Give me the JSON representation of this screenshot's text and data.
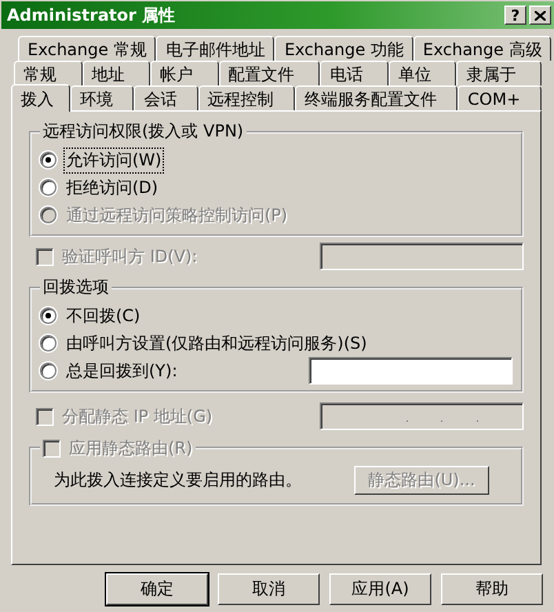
{
  "window": {
    "title": "Administrator 属性",
    "help_button": "?"
  },
  "tab_rows": [
    {
      "tabs": [
        {
          "label": "Exchange 常规",
          "selected": false
        },
        {
          "label": "电子邮件地址",
          "selected": false
        },
        {
          "label": "Exchange 功能",
          "selected": false
        },
        {
          "label": "Exchange 高级",
          "selected": false
        }
      ]
    },
    {
      "tabs": [
        {
          "label": "常规",
          "selected": false
        },
        {
          "label": "地址",
          "selected": false
        },
        {
          "label": "帐户",
          "selected": false
        },
        {
          "label": "配置文件",
          "selected": false
        },
        {
          "label": "电话",
          "selected": false
        },
        {
          "label": "单位",
          "selected": false
        },
        {
          "label": "隶属于",
          "selected": false
        }
      ]
    },
    {
      "tabs": [
        {
          "label": "拨入",
          "selected": true
        },
        {
          "label": "环境",
          "selected": false
        },
        {
          "label": "会话",
          "selected": false
        },
        {
          "label": "远程控制",
          "selected": false
        },
        {
          "label": "终端服务配置文件",
          "selected": false
        },
        {
          "label": "COM+",
          "selected": false
        }
      ]
    }
  ],
  "remote_access": {
    "legend": "远程访问权限(拨入或 VPN)",
    "options": [
      {
        "label": "允许访问(W)",
        "selected": true,
        "disabled": false,
        "focused": true
      },
      {
        "label": "拒绝访问(D)",
        "selected": false,
        "disabled": false,
        "focused": false
      },
      {
        "label": "通过远程访问策略控制访问(P)",
        "selected": false,
        "disabled": true,
        "focused": false
      }
    ]
  },
  "verify_caller_id": {
    "label": "验证呼叫方 ID(V):",
    "checked": false,
    "disabled": true
  },
  "callback": {
    "legend": "回拨选项",
    "options": [
      {
        "kind": "plain",
        "label": "不回拨(C)",
        "selected": true,
        "disabled": false
      },
      {
        "kind": "plain",
        "label": "由呼叫方设置(仅路由和远程访问服务)(S)",
        "selected": false,
        "disabled": false
      },
      {
        "kind": "with_field",
        "label": "总是回拨到(Y):",
        "selected": false,
        "disabled": false
      }
    ]
  },
  "static_ip": {
    "label": "分配静态 IP 地址(G)",
    "checked": false,
    "disabled": true
  },
  "static_routes": {
    "label": "应用静态路由(R)",
    "checked": false,
    "disabled": true,
    "description": "为此拨入连接定义要启用的路由。",
    "button": {
      "label": "静态路由(U)...",
      "disabled": true
    }
  },
  "buttons": [
    {
      "label": "确定",
      "default": true
    },
    {
      "label": "取消",
      "default": false
    },
    {
      "label": "应用(A)",
      "default": false
    },
    {
      "label": "帮助",
      "default": false
    }
  ]
}
